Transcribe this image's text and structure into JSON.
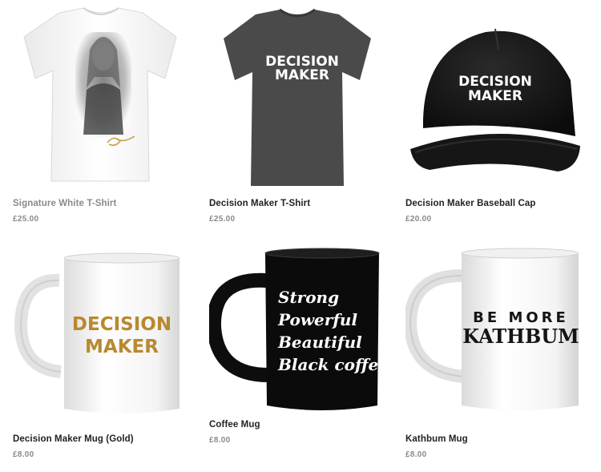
{
  "products": [
    {
      "name": "Signature White T-Shirt",
      "price": "£25.00",
      "image": "white-tshirt-portrait-print"
    },
    {
      "name": "Decision Maker T-Shirt",
      "price": "£25.00",
      "image": "charcoal-tshirt",
      "print_lines": [
        "DECISION",
        "MAKER"
      ]
    },
    {
      "name": "Decision Maker Baseball Cap",
      "price": "£20.00",
      "image": "black-baseball-cap",
      "print_lines": [
        "DECISION",
        "MAKER"
      ]
    },
    {
      "name": "Decision Maker Mug (Gold)",
      "price": "£8.00",
      "image": "white-mug-gold-print",
      "print_lines": [
        "DECISION",
        "MAKER"
      ]
    },
    {
      "name": "Coffee Mug",
      "price": "£8.00",
      "image": "black-mug",
      "print_lines": [
        "Strong",
        "Powerful",
        "Beautiful",
        "Black coffee"
      ]
    },
    {
      "name": "Kathbum Mug",
      "price": "£8.00",
      "image": "white-mug-black-print",
      "print_lines": [
        "BE MORE",
        "KATHBUM"
      ]
    }
  ],
  "colors": {
    "gold_print": "#b8892e",
    "price_text": "#8a8a8a",
    "tshirt_charcoal": "#4a4a4a",
    "cap_black": "#141414"
  }
}
